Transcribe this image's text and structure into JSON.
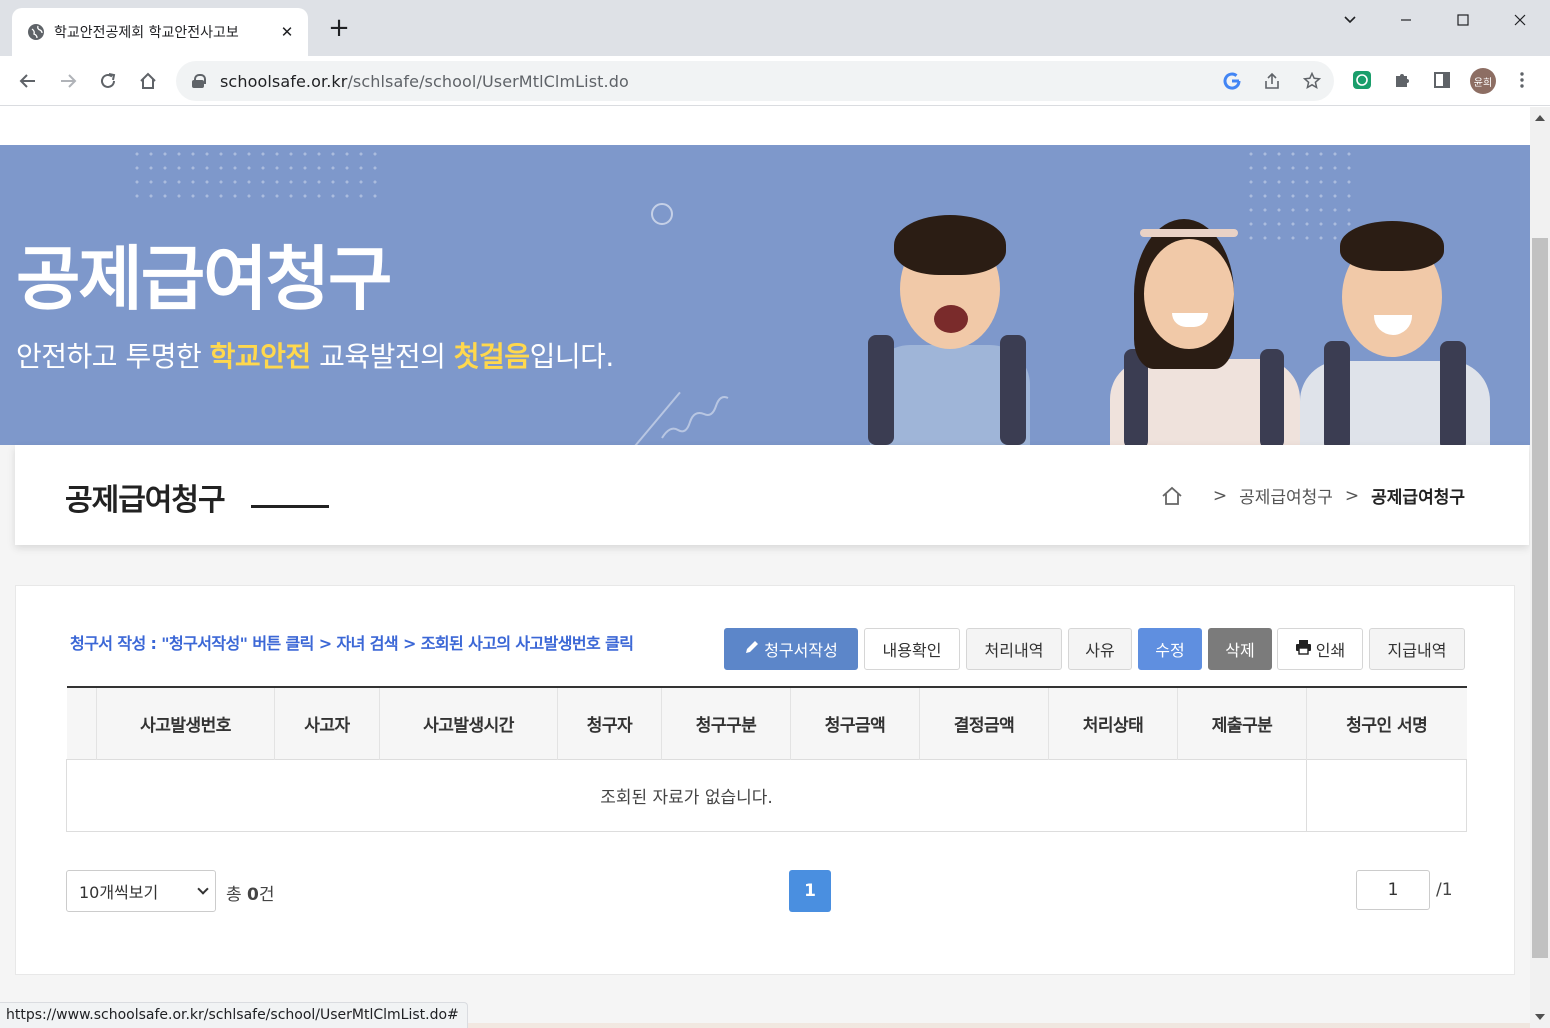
{
  "browser": {
    "tab_title": "학교안전공제회 학교안전사고보",
    "tab_close": "✕",
    "new_tab": "+",
    "url_host": "schoolsafe.or.kr",
    "url_path": "/schlsafe/school/UserMtlClmList.do",
    "avatar_label": "윤희",
    "status_url": "https://www.schoolsafe.or.kr/schlsafe/school/UserMtlClmList.do#",
    "window_controls": [
      "⌄",
      "—",
      "☐",
      "✕"
    ]
  },
  "banner": {
    "title": "공제급여청구",
    "subtitle_part1": "안전하고 투명한 ",
    "subtitle_hl1": "학교안전",
    "subtitle_part2": " 교육발전의 ",
    "subtitle_hl2": "첫걸음",
    "subtitle_part3": "입니다.",
    "accent": "#7e98cb",
    "highlight_color": "#ffd84d"
  },
  "header": {
    "page_title": "공제급여청구",
    "breadcrumb": {
      "home_icon": "home-icon",
      "separator": ">",
      "items": [
        "공제급여청구",
        "공제급여청구"
      ]
    }
  },
  "toolbar": {
    "guide_text": "청구서 작성 : \"청구서작성\" 버튼 클릭 > 자녀 검색 > 조회된 사고의 사고발생번호 클릭",
    "buttons": {
      "write": "청구서작성",
      "confirm": "내용확인",
      "history": "처리내역",
      "reason": "사유",
      "edit": "수정",
      "delete": "삭제",
      "print": "인쇄",
      "payment": "지급내역"
    }
  },
  "table": {
    "columns": [
      "사고발생번호",
      "사고자",
      "사고발생시간",
      "청구자",
      "청구구분",
      "청구금액",
      "결정금액",
      "처리상태",
      "제출구분",
      "청구인 서명"
    ],
    "empty_message": "조회된 자료가 없습니다."
  },
  "pagination": {
    "page_size_label": "10개씩보기",
    "total_prefix": "총 ",
    "total_count": "0",
    "total_suffix": "건",
    "current_page": "1",
    "page_input_value": "1",
    "page_total": "/1"
  }
}
